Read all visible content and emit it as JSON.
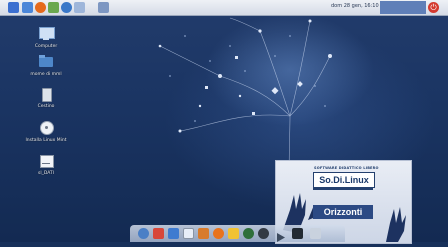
{
  "top_panel": {
    "clock": "dom 28 gen, 16:10",
    "launchers": [
      {
        "name": "applications-menu-icon",
        "color": "#3b6fd0"
      },
      {
        "name": "file-manager-icon",
        "color": "#4b86d8"
      },
      {
        "name": "firefox-icon",
        "color": "#e56a1c"
      },
      {
        "name": "image-viewer-icon",
        "color": "#6aa84f"
      },
      {
        "name": "network-icon",
        "color": "#3a78c8"
      },
      {
        "name": "document-icon",
        "color": "#9eb6da"
      },
      {
        "name": "window-list-icon",
        "color": "#7d97c2"
      }
    ],
    "power_icon": "power-icon"
  },
  "desktop_icons": [
    {
      "label": "Computer",
      "icon": "computer-icon"
    },
    {
      "label": "mome di mml",
      "icon": "home-folder-icon"
    },
    {
      "label": "Cestino",
      "icon": "trash-icon"
    },
    {
      "label": "Installa Linux Mint",
      "icon": "disc-icon"
    },
    {
      "label": "sl_DATI",
      "icon": "drive-icon"
    }
  ],
  "wallpaper": {
    "subtitle": "SOFTWARE DIDATTICO LIBERO",
    "title": "So.Di.Linux",
    "brand": "Orizzonti"
  },
  "dock": {
    "items": [
      {
        "name": "settings-icon",
        "color": "#4a7fc6"
      },
      {
        "name": "mail-icon",
        "color": "#d8473a"
      },
      {
        "name": "text-editor-icon",
        "color": "#3f7bd0"
      },
      {
        "name": "calculator-icon",
        "color": "#e8eef8"
      },
      {
        "name": "presentation-icon",
        "color": "#d87b2c"
      },
      {
        "name": "firefox-icon",
        "color": "#e8731d"
      },
      {
        "name": "brush-icon",
        "color": "#f1c232"
      },
      {
        "name": "globe-icon",
        "color": "#2f6f3a"
      },
      {
        "name": "webcam-icon",
        "color": "#333a44"
      },
      {
        "name": "play-icon",
        "color": "#3c4a5e"
      },
      {
        "name": "clapperboard-icon",
        "color": "#222a33"
      },
      {
        "name": "trash-bin-icon",
        "color": "#c9d2de"
      }
    ]
  }
}
